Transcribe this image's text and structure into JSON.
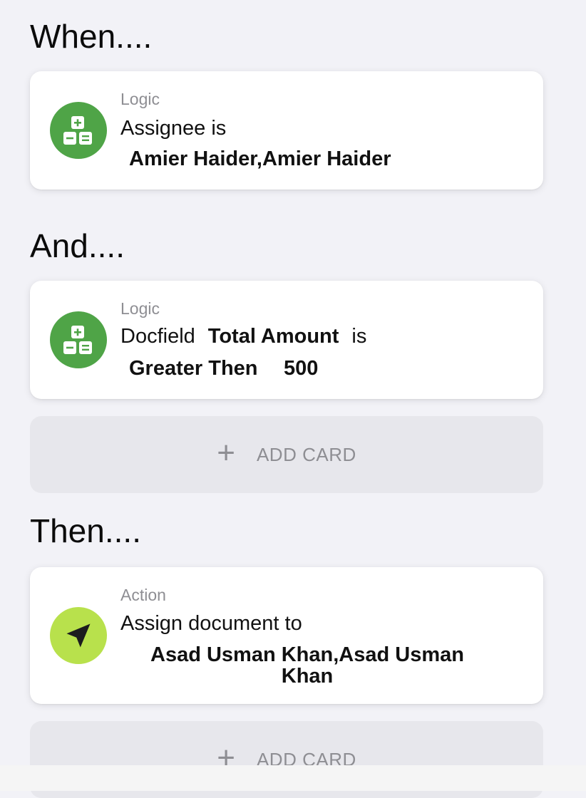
{
  "sections": {
    "when": "When....",
    "and": "And....",
    "then": "Then...."
  },
  "cards": {
    "when_card": {
      "type": "Logic",
      "icon": "calculator-icon",
      "line1": "Assignee is",
      "value": "Amier Haider,Amier Haider"
    },
    "and_card": {
      "type": "Logic",
      "icon": "calculator-icon",
      "prefix": "Docfield",
      "field": "Total Amount",
      "suffix": "is",
      "operator": "Greater Then",
      "operand": "500"
    },
    "then_card": {
      "type": "Action",
      "icon": "navigation-arrow-icon",
      "line1": "Assign document to",
      "value_line1": "Asad Usman Khan,Asad Usman",
      "value_line2": "Khan"
    }
  },
  "add_card": {
    "plus": "+",
    "label": "ADD CARD"
  },
  "colors": {
    "logic_icon_bg": "#4fa447",
    "action_icon_bg": "#b8e14c",
    "background": "#f2f2f7",
    "muted_text": "#8e8e93"
  }
}
